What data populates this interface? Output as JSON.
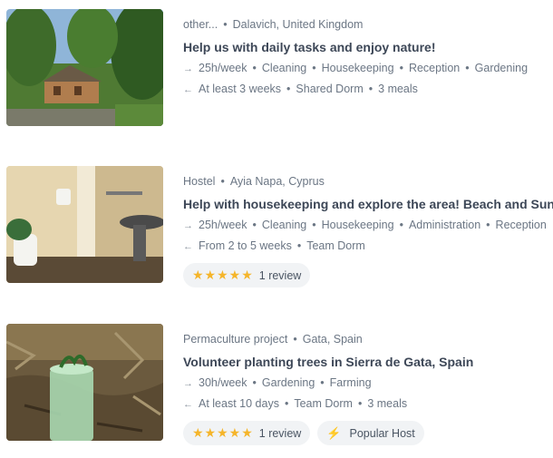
{
  "listings": [
    {
      "category": "other...",
      "location": "Dalavich, United Kingdom",
      "title": "Help us with daily tasks and enjoy nature!",
      "hours": "25h/week",
      "tasks": [
        "Cleaning",
        "Housekeeping",
        "Reception",
        "Gardening"
      ],
      "duration": "At least 3 weeks",
      "extras": [
        "Shared Dorm",
        "3 meals"
      ],
      "image_icon": "cabin-photo"
    },
    {
      "category": "Hostel",
      "location": "Ayia Napa, Cyprus",
      "title": "Help with housekeeping and explore the area! Beach and Sun!",
      "hours": "25h/week",
      "tasks": [
        "Cleaning",
        "Housekeeping",
        "Administration",
        "Reception"
      ],
      "duration": "From 2 to 5 weeks",
      "extras": [
        "Team Dorm"
      ],
      "rating_stars": 5,
      "review_label": "1 review",
      "image_icon": "bathroom-photo"
    },
    {
      "category": "Permaculture project",
      "location": "Gata, Spain",
      "title": "Volunteer planting trees in Sierra de Gata, Spain",
      "hours": "30h/week",
      "tasks": [
        "Gardening",
        "Farming"
      ],
      "duration": "At least 10 days",
      "extras": [
        "Team Dorm",
        "3 meals"
      ],
      "rating_stars": 5,
      "review_label": "1 review",
      "badge_label": "Popular Host",
      "badge_icon": "lightning-icon",
      "image_icon": "tree-guard-photo"
    }
  ],
  "colors": {
    "star": "#f5b52a",
    "chip_bg": "#f1f3f5",
    "title": "#3d4757",
    "meta": "#6b7684"
  }
}
